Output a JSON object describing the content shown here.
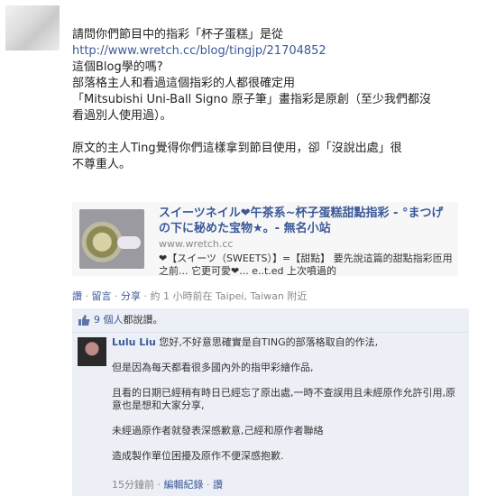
{
  "post": {
    "lines": [
      "請問你們節目中的指彩「杯子蛋糕」是從",
      "這個Blog學的嗎?",
      "部落格主人和看過這個指彩的人都很確定用",
      "「Mitsubishi Uni-Ball Signo 原子筆」畫指彩是原創（至少我們都沒",
      "看過別人使用過）。",
      "原文的主人Ting覺得你們這樣拿到節目使用，卻「沒說出處」很",
      "不尊重人。"
    ],
    "link": "http://www.wretch.cc/blog/tingjp/21704852"
  },
  "share": {
    "title": "スイーツネイル❤午茶系~杯子蛋糕甜點指彩 - °まつげの下に秘めた宝物★。- 無名小站",
    "url": "www.wretch.cc",
    "desc": "❤【スイーツ（SWEETS）】=【甜點】 要先說這篇的甜點指彩匝用之前... 它更可愛❤... e..t.ed 上次噴過的"
  },
  "meta": {
    "like": "讚",
    "comment": "留言",
    "share": "分享",
    "time": "約 1 小時前在 Taipei, Taiwan 附近"
  },
  "likes": {
    "count": "9 個人",
    "suffix": "都說讚。"
  },
  "comment": {
    "author": "Lulu Liu",
    "first": "您好,不好意思確實是自TING的部落格取自的作法,",
    "paras": [
      "但是因為每天都看很多國內外的指甲彩繪作品,",
      "且看的日期已經稍有時日已經忘了原出處,一時不查誤用且未經原作允許引用,原意也是想和大家分享,",
      "未經過原作者就發表深感歉意,己經和原作者聯絡",
      "造成製作單位困擾及原作不便深感抱歉."
    ],
    "time": "15分鐘前",
    "history": "編輯紀錄",
    "like": "讚"
  },
  "colors": {
    "link": "#3b5998",
    "bg_comment": "#eceff5"
  }
}
